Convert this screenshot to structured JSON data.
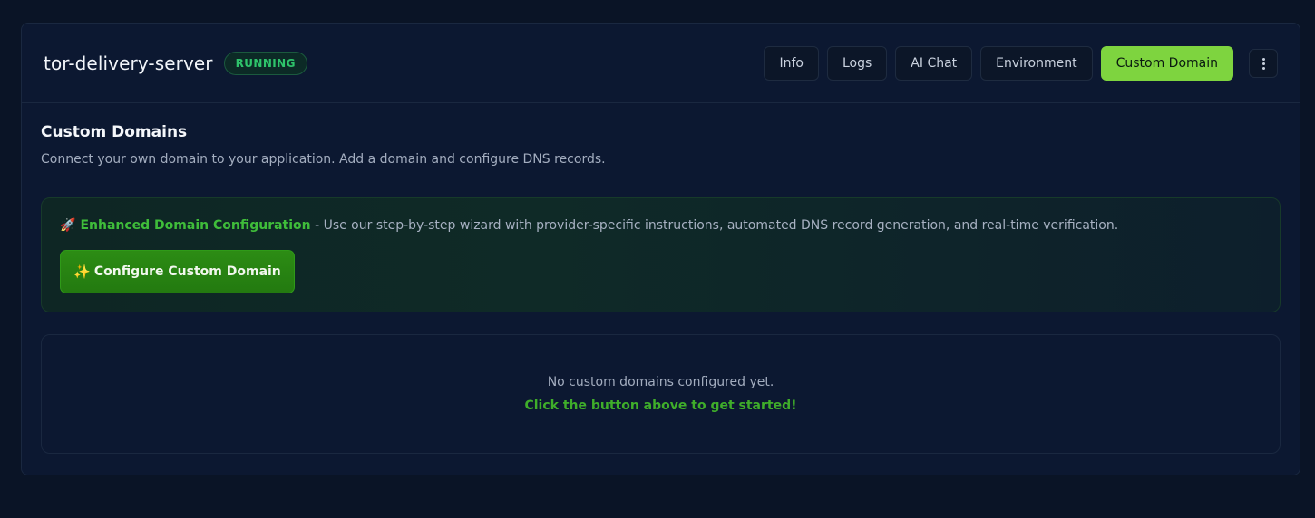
{
  "header": {
    "app_name": "tor-delivery-server",
    "status": "RUNNING"
  },
  "tabs": [
    {
      "label": "Info",
      "active": false
    },
    {
      "label": "Logs",
      "active": false
    },
    {
      "label": "AI Chat",
      "active": false
    },
    {
      "label": "Environment",
      "active": false
    },
    {
      "label": "Custom Domain",
      "active": true
    }
  ],
  "menu": {
    "icon": "kebab-menu-icon"
  },
  "section": {
    "title": "Custom Domains",
    "description": "Connect your own domain to your application. Add a domain and configure DNS records."
  },
  "feature": {
    "icon": "🚀",
    "title": "Enhanced Domain Configuration",
    "text": " - Use our step-by-step wizard with provider-specific instructions, automated DNS record generation, and real-time verification.",
    "button_icon": "✨",
    "button_label": "Configure Custom Domain"
  },
  "empty_state": {
    "message": "No custom domains configured yet.",
    "cta": "Click the button above to get started!"
  },
  "colors": {
    "accent": "#7ed43f",
    "status_green": "#2ec46b",
    "button_green": "#2c8c14",
    "background": "#0a1426"
  }
}
